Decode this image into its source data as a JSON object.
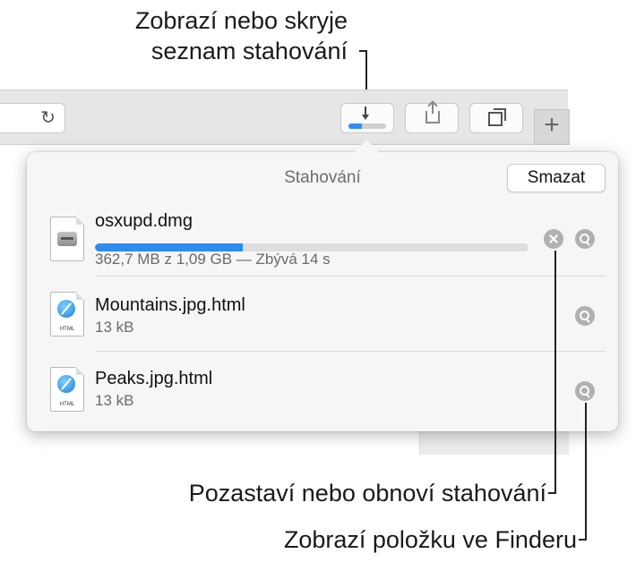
{
  "callouts": {
    "downloads_toggle_line1": "Zobrazí nebo skryje",
    "downloads_toggle_line2": "seznam stahování",
    "pause_resume": "Pozastaví nebo obnoví stahování",
    "show_in_finder": "Zobrazí položku ve Finderu"
  },
  "toolbar": {
    "download_progress": 0.35,
    "new_tab_label": "+"
  },
  "downloads": {
    "title": "Stahování",
    "clear_label": "Smazat",
    "items": [
      {
        "name": "osxupd.dmg",
        "status": "362,7 MB z 1,09 GB — Zbývá 14 s",
        "progress": 0.34,
        "icon": "disk-image-icon",
        "in_progress": true
      },
      {
        "name": "Mountains.jpg.html",
        "status": "13 kB",
        "icon": "html-file-icon",
        "icon_label": "HTML"
      },
      {
        "name": "Peaks.jpg.html",
        "status": "13 kB",
        "icon": "html-file-icon",
        "icon_label": "HTML"
      }
    ]
  },
  "colors": {
    "accent": "#2d8cf0",
    "popover_bg": "#f6f6f6",
    "toolbar_bg": "#e6e6e6"
  }
}
